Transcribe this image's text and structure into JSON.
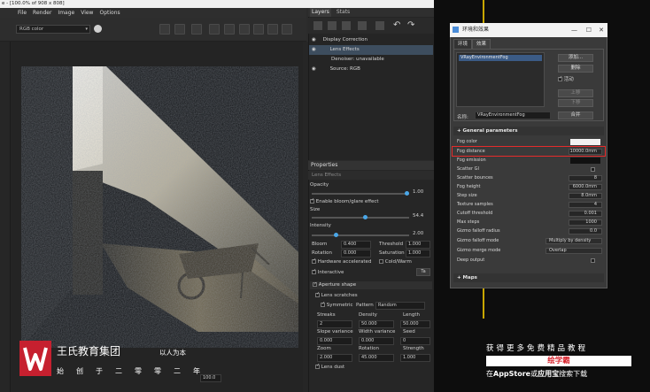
{
  "vfb": {
    "title": "e - [100.0% of 908 x 808]",
    "menu": [
      "File",
      "Render",
      "Image",
      "View",
      "Options"
    ],
    "channel": "RGB color",
    "zoom_value": "100.0"
  },
  "layers_panel": {
    "tabs": [
      "Layers",
      "Stats"
    ],
    "items": [
      {
        "label": "Display Correction",
        "indent": 0
      },
      {
        "label": "Lens Effects",
        "indent": 1,
        "selected": true
      },
      {
        "label": "Denoiser: unavailable",
        "indent": 1
      },
      {
        "label": "Source: RGB",
        "indent": 1
      }
    ]
  },
  "properties": {
    "title": "Properties",
    "subtitle": "Lens Effects",
    "opacity_label": "Opacity",
    "opacity_value": "1.00",
    "opacity_fraction": 0.98,
    "enable_bloom": "Enable bloom/glare effect",
    "size_label": "Size",
    "size_value": "54.4",
    "size_fraction": 0.55,
    "intensity_label": "Intensity",
    "intensity_value": "2.00",
    "intensity_fraction": 0.25,
    "bloom_label": "Bloom",
    "bloom_value": "0.400",
    "threshold_label": "Threshold",
    "threshold_value": "1.000",
    "rotation_label": "Rotation",
    "rotation_value": "0.000",
    "saturation_label": "Saturation",
    "saturation_value": "1.000",
    "hw_accel": "Hardware accelerated",
    "cold_warm": "Cold/Warm",
    "interactive": "Interactive",
    "aperture_section": "Aperture shape",
    "lens_scratches": "Lens scratches",
    "symmetric": "Symmetric",
    "pattern_label": "Pattern",
    "pattern_value": "Random",
    "streaks_label": "Streaks",
    "streaks_value": "2",
    "density_label": "Density",
    "density_value": "50.000",
    "length_label": "Length",
    "length_value": "50.000",
    "slope_label": "Slope variance",
    "slope_value": "0.000",
    "width_label": "Width variance",
    "width_value": "0.000",
    "seed_label": "Seed",
    "seed_value": "0",
    "zoom_label": "Zoom",
    "zoom_value": "2.000",
    "rotation2_label": "Rotation",
    "rotation2_value": "45.000",
    "strength_label": "Strength",
    "strength_value": "1.000",
    "lens_dust": "Lens dust"
  },
  "dialog": {
    "title": "环境和效果",
    "tabs": [
      "环境",
      "效果"
    ],
    "effect_item": "VRayEnvironmentFog",
    "buttons": {
      "add": "添加...",
      "delete": "删除",
      "active": "活动",
      "move_up": "上移",
      "move_down": "下移",
      "merge": "合并"
    },
    "name_label": "名称:",
    "name_value": "VRayEnvironmentFog",
    "general_rollout": "General parameters",
    "params": [
      {
        "label": "Fog color",
        "type": "color-white"
      },
      {
        "label": "Fog distance",
        "value": "10000.0mm",
        "type": "spin",
        "highlight": true
      },
      {
        "label": "Fog emission",
        "type": "color-black"
      },
      {
        "label": "Scatter GI",
        "type": "check"
      },
      {
        "label": "Scatter bounces",
        "value": "8",
        "type": "spin"
      },
      {
        "label": "Fog height",
        "value": "6000.0mm",
        "type": "spin"
      },
      {
        "label": "Step size",
        "value": "8.0mm",
        "type": "spin"
      },
      {
        "label": "Texture samples",
        "value": "4",
        "type": "spin"
      },
      {
        "label": "Cutoff threshold",
        "value": "0.001",
        "type": "spin"
      },
      {
        "label": "Max steps",
        "value": "1000",
        "type": "spin"
      },
      {
        "label": "Gizmo falloff radius",
        "value": "0.0",
        "type": "spin"
      },
      {
        "label": "Gizmo falloff mode",
        "value": "Multiply by density",
        "type": "dropdown"
      },
      {
        "label": "Gizmo merge mode",
        "value": "Overlap",
        "type": "dropdown"
      },
      {
        "label": "Deep output",
        "type": "check"
      }
    ],
    "maps_rollout": "Maps"
  },
  "branding": {
    "company": "王氏教育集团",
    "slogan": "以人为本",
    "since": "始创于二零零二年",
    "promo_line1": "获得更多免费精品教程",
    "promo_button": "绘学霸",
    "promo_line2_a": "在",
    "promo_line2_b": "AppStore",
    "promo_line2_c": "或",
    "promo_line2_d": "应用宝",
    "promo_line2_e": "搜索下载"
  },
  "colors": {
    "accent_blue": "#4aa7e8",
    "highlight_red": "#e52b2b",
    "logo_red": "#c6202f",
    "selection": "#3b5b86"
  }
}
